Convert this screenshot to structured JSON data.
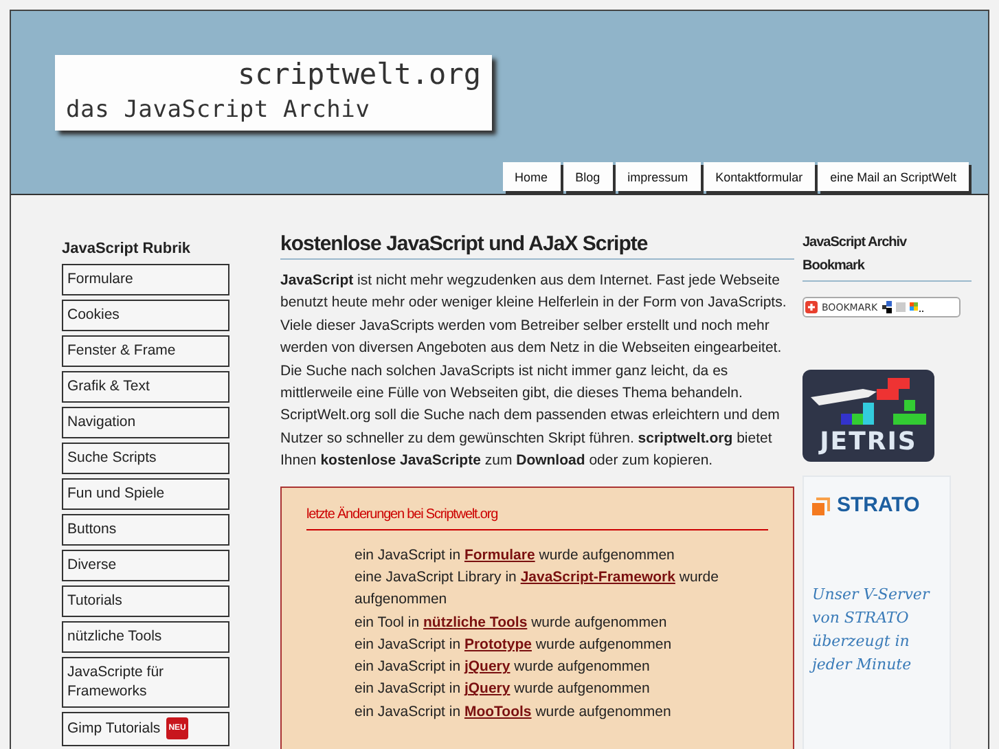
{
  "header": {
    "logo_title": "scriptwelt.org",
    "logo_subtitle": "das JavaScript Archiv",
    "nav": [
      {
        "label": "Home"
      },
      {
        "label": "Blog"
      },
      {
        "label": "impressum"
      },
      {
        "label": "Kontaktformular"
      },
      {
        "label": "eine Mail an ScriptWelt"
      }
    ]
  },
  "sidebar": {
    "title": "JavaScript Rubrik",
    "items": [
      {
        "label": "Formulare"
      },
      {
        "label": "Cookies"
      },
      {
        "label": "Fenster & Frame"
      },
      {
        "label": "Grafik & Text"
      },
      {
        "label": "Navigation"
      },
      {
        "label": "Suche Scripts"
      },
      {
        "label": "Fun und Spiele"
      },
      {
        "label": "Buttons"
      },
      {
        "label": "Diverse"
      },
      {
        "label": "Tutorials"
      },
      {
        "label": "nützliche Tools"
      },
      {
        "label": "JavaScripte für Frameworks"
      },
      {
        "label": "Gimp Tutorials",
        "badge": "NEU"
      }
    ]
  },
  "main": {
    "title": "kostenlose JavaScript und AJaX Scripte",
    "intro": "**JavaScript** ist nicht mehr wegzudenken aus dem Internet. Fast jede Webseite benutzt heute mehr oder weniger kleine Helferlein in der Form von JavaScripts. Viele dieser JavaScripts werden vom Betreiber selber erstellt und noch mehr werden von diversen Angeboten aus dem Netz in die Webseiten eingearbeitet. Die Suche nach solchen JavaScripts ist nicht immer ganz leicht, da es mittlerweile eine Fülle von Webseiten gibt, die dieses Thema behandeln. ScriptWelt.org soll die Suche nach dem passenden etwas erleichtern und dem Nutzer so schneller zu dem gewünschten Skript führen. **scriptwelt.org** bietet Ihnen **kostenlose JavaScripte** zum **Download** oder zum kopieren.",
    "changes": {
      "title": "letzte Änderungen bei Scriptwelt.org",
      "items": [
        {
          "before": "ein JavaScript in",
          "link": "Formulare",
          "after": "wurde aufgenommen"
        },
        {
          "before": "eine JavaScript Library in",
          "link": "JavaScript-Framework",
          "after": "wurde aufgenommen"
        },
        {
          "before": "ein Tool in",
          "link": "nützliche Tools",
          "after": "wurde aufgenommen"
        },
        {
          "before": "ein JavaScript in",
          "link": "Prototype",
          "after": "wurde aufgenommen"
        },
        {
          "before": "ein JavaScript in",
          "link": "jQuery",
          "after": "wurde aufgenommen"
        },
        {
          "before": "ein JavaScript in",
          "link": "jQuery",
          "after": "wurde aufgenommen"
        },
        {
          "before": "ein JavaScript in",
          "link": "MooTools",
          "after": "wurde aufgenommen"
        }
      ]
    }
  },
  "right": {
    "title": "JavaScript Archiv Bookmark",
    "bookmark_label": "BOOKMARK",
    "game_ad": {
      "text": "JETRIS"
    },
    "hosting_ad": {
      "brand": "STRATO",
      "slogan": "Unser V-Server von STRATO überzeugt in jeder Minute"
    }
  }
}
